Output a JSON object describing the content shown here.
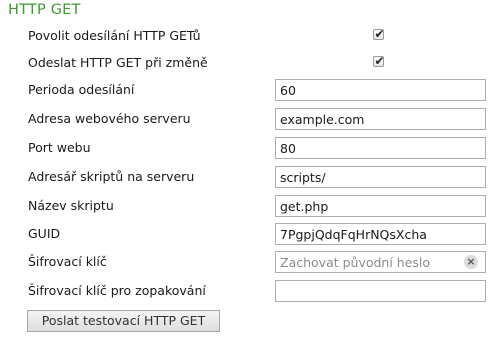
{
  "section": {
    "title": "HTTP GET"
  },
  "rows": {
    "enable_get": {
      "label": "Povolit odesílání HTTP GETů",
      "checked": true
    },
    "send_on_change": {
      "label": "Odeslat HTTP GET při změně",
      "checked": true
    },
    "period": {
      "label": "Perioda odesílání",
      "value": "60"
    },
    "server_address": {
      "label": "Adresa webového serveru",
      "value": "example.com"
    },
    "port": {
      "label": "Port webu",
      "value": "80"
    },
    "script_dir": {
      "label": "Adresář skriptů na serveru",
      "value": "scripts/"
    },
    "script_name": {
      "label": "Název skriptu",
      "value": "get.php"
    },
    "guid": {
      "label": "GUID",
      "value": "7PgpjQdqFqHrNQsXcha"
    },
    "encryption_key": {
      "label": "Šifrovací klíč",
      "value": "",
      "placeholder": "Zachovat původní heslo",
      "clear_icon": "×"
    },
    "encryption_key_repeat": {
      "label": "Šifrovací klíč pro zopakování",
      "value": ""
    }
  },
  "check_glyph": "✔",
  "buttons": {
    "test_label": "Poslat testovací HTTP GET"
  }
}
